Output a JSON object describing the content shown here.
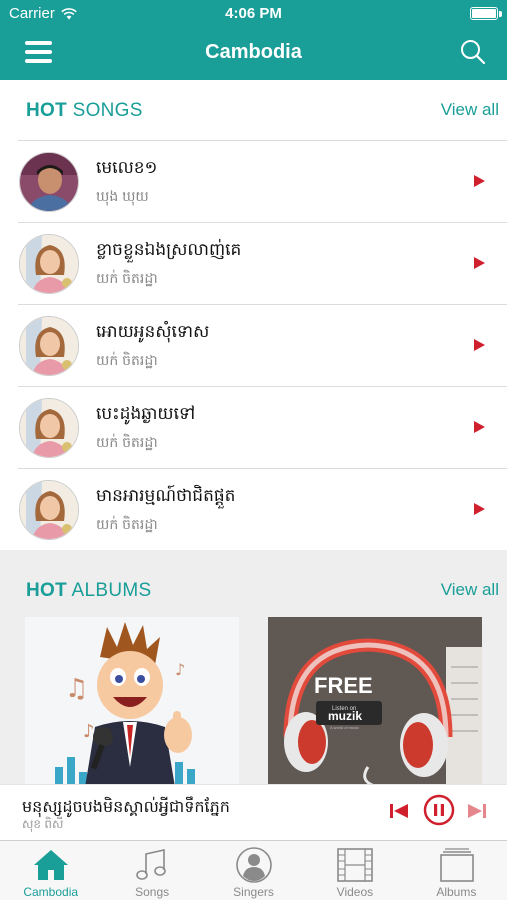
{
  "colors": {
    "accent": "#1a9e98",
    "play": "#d0202e",
    "muted": "#888888"
  },
  "status_bar": {
    "carrier": "Carrier",
    "time": "4:06 PM"
  },
  "nav": {
    "title": "Cambodia",
    "menu_icon": "hamburger-menu-icon",
    "search_icon": "search-icon"
  },
  "hot_songs": {
    "title_bold": "HOT",
    "title_rest": " SONGS",
    "view_all": "View all",
    "items": [
      {
        "title": "មេលេខ១",
        "artist": "ឃុង ឃុយ"
      },
      {
        "title": "ខ្លាចខ្លួនឯងស្រលាញ់គេ",
        "artist": "យក់ ចិតរដ្ឋា"
      },
      {
        "title": "អោយអូនសុំទោស",
        "artist": "យក់ ចិតរដ្ឋា"
      },
      {
        "title": "បេះដូងឆ្ងាយទៅ",
        "artist": "យក់ ចិតរដ្ឋា"
      },
      {
        "title": "មានអារម្មណ៍ថាជិតផ្តួត",
        "artist": "យក់ ចិតរដ្ឋា"
      }
    ]
  },
  "hot_albums": {
    "title_bold": "HOT",
    "title_rest": " ALBUMS",
    "view_all": "View all",
    "album2_text": {
      "free": "FREE",
      "listen_on": "Listen on",
      "brand": "muzik",
      "tagline": "A world of music"
    }
  },
  "now_playing": {
    "title": "មនុស្សដូចបងមិនស្គាល់អ្វីជាទឹកភ្នែក",
    "artist": "សុខ ពិសី"
  },
  "tabs": [
    {
      "label": "Cambodia",
      "icon": "home-icon",
      "active": true
    },
    {
      "label": "Songs",
      "icon": "music-note-icon",
      "active": false
    },
    {
      "label": "Singers",
      "icon": "singer-avatar-icon",
      "active": false
    },
    {
      "label": "Videos",
      "icon": "film-strip-icon",
      "active": false
    },
    {
      "label": "Albums",
      "icon": "album-stack-icon",
      "active": false
    }
  ]
}
